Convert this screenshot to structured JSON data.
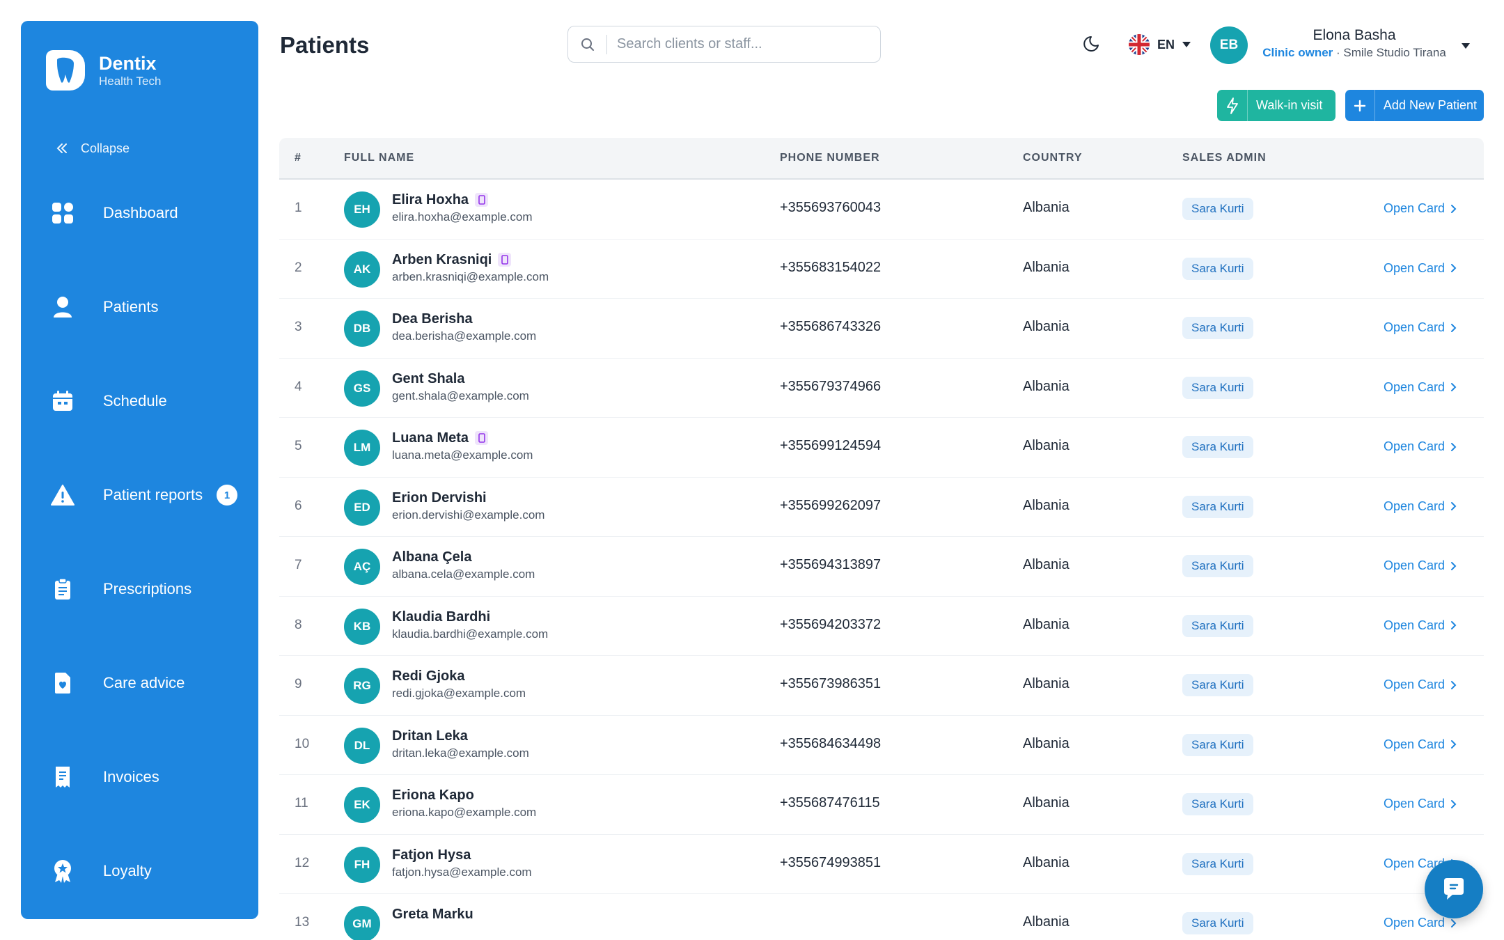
{
  "brand": {
    "name": "Dentix",
    "sub": "Health Tech"
  },
  "sidebar": {
    "collapse_label": "Collapse",
    "items": [
      {
        "label": "Dashboard",
        "icon": "dashboard-icon"
      },
      {
        "label": "Patients",
        "icon": "user-icon"
      },
      {
        "label": "Schedule",
        "icon": "calendar-icon"
      },
      {
        "label": "Patient reports",
        "icon": "warning-icon",
        "badge": "1"
      },
      {
        "label": "Prescriptions",
        "icon": "clipboard-icon"
      },
      {
        "label": "Care advice",
        "icon": "heart-document-icon"
      },
      {
        "label": "Invoices",
        "icon": "receipt-icon"
      },
      {
        "label": "Loyalty",
        "icon": "award-icon"
      }
    ]
  },
  "header": {
    "title": "Patients",
    "search_placeholder": "Search clients or staff...",
    "language": "EN",
    "user": {
      "initials": "EB",
      "name": "Elona Basha",
      "role": "Clinic owner",
      "clinic": " · Smile Studio Tirana"
    }
  },
  "actions": {
    "walkin_label": "Walk-in visit",
    "add_label": "Add New Patient"
  },
  "table": {
    "columns": [
      "#",
      "FULL NAME",
      "PHONE NUMBER",
      "COUNTRY",
      "SALES ADMIN"
    ],
    "open_label": "Open Card",
    "rows": [
      {
        "num": "1",
        "initials": "EH",
        "name": "Elira Hoxha",
        "email": "elira.hoxha@example.com",
        "phone": "+355693760043",
        "country": "Albania",
        "admin": "Sara Kurti",
        "mobile": true
      },
      {
        "num": "2",
        "initials": "AK",
        "name": "Arben Krasniqi",
        "email": "arben.krasniqi@example.com",
        "phone": "+355683154022",
        "country": "Albania",
        "admin": "Sara Kurti",
        "mobile": true
      },
      {
        "num": "3",
        "initials": "DB",
        "name": "Dea Berisha",
        "email": "dea.berisha@example.com",
        "phone": "+355686743326",
        "country": "Albania",
        "admin": "Sara Kurti",
        "mobile": false
      },
      {
        "num": "4",
        "initials": "GS",
        "name": "Gent Shala",
        "email": "gent.shala@example.com",
        "phone": "+355679374966",
        "country": "Albania",
        "admin": "Sara Kurti",
        "mobile": false
      },
      {
        "num": "5",
        "initials": "LM",
        "name": "Luana Meta",
        "email": "luana.meta@example.com",
        "phone": "+355699124594",
        "country": "Albania",
        "admin": "Sara Kurti",
        "mobile": true
      },
      {
        "num": "6",
        "initials": "ED",
        "name": "Erion Dervishi",
        "email": "erion.dervishi@example.com",
        "phone": "+355699262097",
        "country": "Albania",
        "admin": "Sara Kurti",
        "mobile": false
      },
      {
        "num": "7",
        "initials": "AÇ",
        "name": "Albana Çela",
        "email": "albana.cela@example.com",
        "phone": "+355694313897",
        "country": "Albania",
        "admin": "Sara Kurti",
        "mobile": false
      },
      {
        "num": "8",
        "initials": "KB",
        "name": "Klaudia Bardhi",
        "email": "klaudia.bardhi@example.com",
        "phone": "+355694203372",
        "country": "Albania",
        "admin": "Sara Kurti",
        "mobile": false
      },
      {
        "num": "9",
        "initials": "RG",
        "name": "Redi Gjoka",
        "email": "redi.gjoka@example.com",
        "phone": "+355673986351",
        "country": "Albania",
        "admin": "Sara Kurti",
        "mobile": false
      },
      {
        "num": "10",
        "initials": "DL",
        "name": "Dritan Leka",
        "email": "dritan.leka@example.com",
        "phone": "+355684634498",
        "country": "Albania",
        "admin": "Sara Kurti",
        "mobile": false
      },
      {
        "num": "11",
        "initials": "EK",
        "name": "Eriona Kapo",
        "email": "eriona.kapo@example.com",
        "phone": "+355687476115",
        "country": "Albania",
        "admin": "Sara Kurti",
        "mobile": false
      },
      {
        "num": "12",
        "initials": "FH",
        "name": "Fatjon Hysa",
        "email": "fatjon.hysa@example.com",
        "phone": "+355674993851",
        "country": "Albania",
        "admin": "Sara Kurti",
        "mobile": false
      },
      {
        "num": "13",
        "initials": "GM",
        "name": "Greta Marku",
        "email": "",
        "phone": "",
        "country": "Albania",
        "admin": "Sara Kurti",
        "mobile": false
      }
    ]
  },
  "colors": {
    "primary": "#1e86df",
    "teal": "#16a3b0",
    "green": "#1fb5a0"
  }
}
